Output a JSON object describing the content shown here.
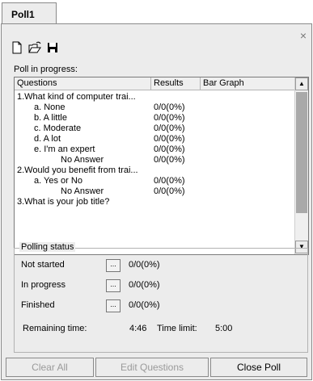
{
  "tab": {
    "label": "Poll1"
  },
  "toolbar": {
    "new_icon": "new-document-icon",
    "open_icon": "open-folder-icon",
    "save_icon": "save-disk-icon"
  },
  "close_label": "×",
  "poll_in_progress_label": "Poll in progress:",
  "list": {
    "headers": {
      "questions": "Questions",
      "results": "Results",
      "bar_graph": "Bar Graph"
    },
    "rows": [
      {
        "text": "1.What kind of computer trai...",
        "indent": 0,
        "result": ""
      },
      {
        "text": "a. None",
        "indent": 2,
        "result": "0/0(0%)"
      },
      {
        "text": "b. A little",
        "indent": 2,
        "result": "0/0(0%)"
      },
      {
        "text": "c. Moderate",
        "indent": 2,
        "result": "0/0(0%)"
      },
      {
        "text": "d. A lot",
        "indent": 2,
        "result": "0/0(0%)"
      },
      {
        "text": "e. I'm an expert",
        "indent": 2,
        "result": "0/0(0%)"
      },
      {
        "text": "No Answer",
        "indent": 3,
        "result": "0/0(0%)"
      },
      {
        "text": "2.Would you benefit from trai...",
        "indent": 0,
        "result": ""
      },
      {
        "text": "a. Yes or No",
        "indent": 2,
        "result": "0/0(0%)"
      },
      {
        "text": "No Answer",
        "indent": 3,
        "result": "0/0(0%)"
      },
      {
        "text": "3.What is your job title?",
        "indent": 0,
        "result": ""
      }
    ]
  },
  "polling_status": {
    "title": "Polling status",
    "items": [
      {
        "label": "Not started",
        "button": "...",
        "value": "0/0(0%)"
      },
      {
        "label": "In progress",
        "button": "...",
        "value": "0/0(0%)"
      },
      {
        "label": "Finished",
        "button": "...",
        "value": "0/0(0%)"
      }
    ],
    "remaining_label": "Remaining time:",
    "remaining_value": "4:46",
    "time_limit_label": "Time limit:",
    "time_limit_value": "5:00"
  },
  "buttons": {
    "clear_all": "Clear All",
    "edit_questions": "Edit Questions",
    "close_poll": "Close Poll"
  }
}
